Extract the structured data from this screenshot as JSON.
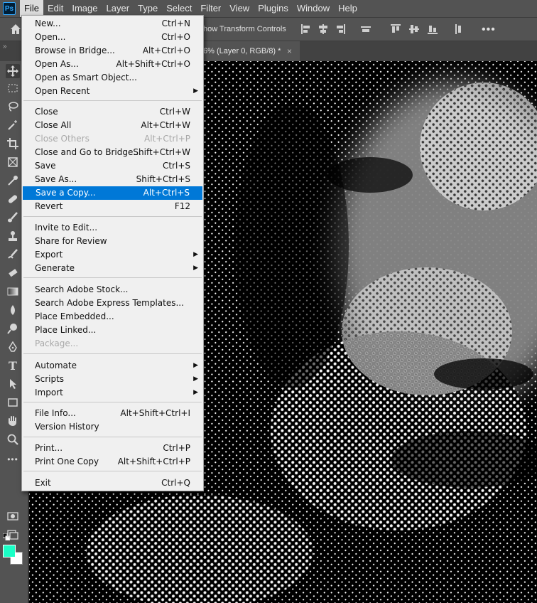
{
  "menubar": {
    "logo": "Ps",
    "items": [
      "File",
      "Edit",
      "Image",
      "Layer",
      "Type",
      "Select",
      "Filter",
      "View",
      "Plugins",
      "Window",
      "Help"
    ],
    "active": "File"
  },
  "options_bar": {
    "transform_label": "how Transform Controls",
    "more": "•••"
  },
  "document_tab": {
    "title": "6% (Layer 0, RGB/8) *",
    "close": "×"
  },
  "panel_toggle": "»",
  "colors": {
    "foreground": "#1affc6",
    "background": "#ffffff",
    "menu_highlight": "#0078d7"
  },
  "file_menu": {
    "items": [
      {
        "label": "New...",
        "shortcut": "Ctrl+N"
      },
      {
        "label": "Open...",
        "shortcut": "Ctrl+O"
      },
      {
        "label": "Browse in Bridge...",
        "shortcut": "Alt+Ctrl+O"
      },
      {
        "label": "Open As...",
        "shortcut": "Alt+Shift+Ctrl+O"
      },
      {
        "label": "Open as Smart Object...",
        "shortcut": ""
      },
      {
        "label": "Open Recent",
        "shortcut": "",
        "submenu": true
      },
      {
        "label": "Close",
        "shortcut": "Ctrl+W"
      },
      {
        "label": "Close All",
        "shortcut": "Alt+Ctrl+W"
      },
      {
        "label": "Close Others",
        "shortcut": "Alt+Ctrl+P",
        "disabled": true
      },
      {
        "label": "Close and Go to Bridge...",
        "shortcut": "Shift+Ctrl+W"
      },
      {
        "label": "Save",
        "shortcut": "Ctrl+S"
      },
      {
        "label": "Save As...",
        "shortcut": "Shift+Ctrl+S"
      },
      {
        "label": "Save a Copy...",
        "shortcut": "Alt+Ctrl+S",
        "highlighted": true
      },
      {
        "label": "Revert",
        "shortcut": "F12"
      },
      {
        "label": "Invite to Edit...",
        "shortcut": ""
      },
      {
        "label": "Share for Review",
        "shortcut": ""
      },
      {
        "label": "Export",
        "shortcut": "",
        "submenu": true
      },
      {
        "label": "Generate",
        "shortcut": "",
        "submenu": true
      },
      {
        "label": "Search Adobe Stock...",
        "shortcut": ""
      },
      {
        "label": "Search Adobe Express Templates...",
        "shortcut": ""
      },
      {
        "label": "Place Embedded...",
        "shortcut": ""
      },
      {
        "label": "Place Linked...",
        "shortcut": ""
      },
      {
        "label": "Package...",
        "shortcut": "",
        "disabled": true
      },
      {
        "label": "Automate",
        "shortcut": "",
        "submenu": true
      },
      {
        "label": "Scripts",
        "shortcut": "",
        "submenu": true
      },
      {
        "label": "Import",
        "shortcut": "",
        "submenu": true
      },
      {
        "label": "File Info...",
        "shortcut": "Alt+Shift+Ctrl+I"
      },
      {
        "label": "Version History",
        "shortcut": ""
      },
      {
        "label": "Print...",
        "shortcut": "Ctrl+P"
      },
      {
        "label": "Print One Copy",
        "shortcut": "Alt+Shift+Ctrl+P"
      },
      {
        "label": "Exit",
        "shortcut": "Ctrl+Q"
      }
    ]
  },
  "tools": [
    "move-tool",
    "marquee-tool",
    "lasso-tool",
    "magic-wand-tool",
    "crop-tool",
    "frame-tool",
    "eyedropper-tool",
    "healing-brush-tool",
    "brush-tool",
    "clone-stamp-tool",
    "history-brush-tool",
    "eraser-tool",
    "gradient-tool",
    "blur-tool",
    "dodge-tool",
    "pen-tool",
    "type-tool",
    "path-selection-tool",
    "rectangle-tool",
    "hand-tool",
    "zoom-tool",
    "edit-toolbar"
  ]
}
